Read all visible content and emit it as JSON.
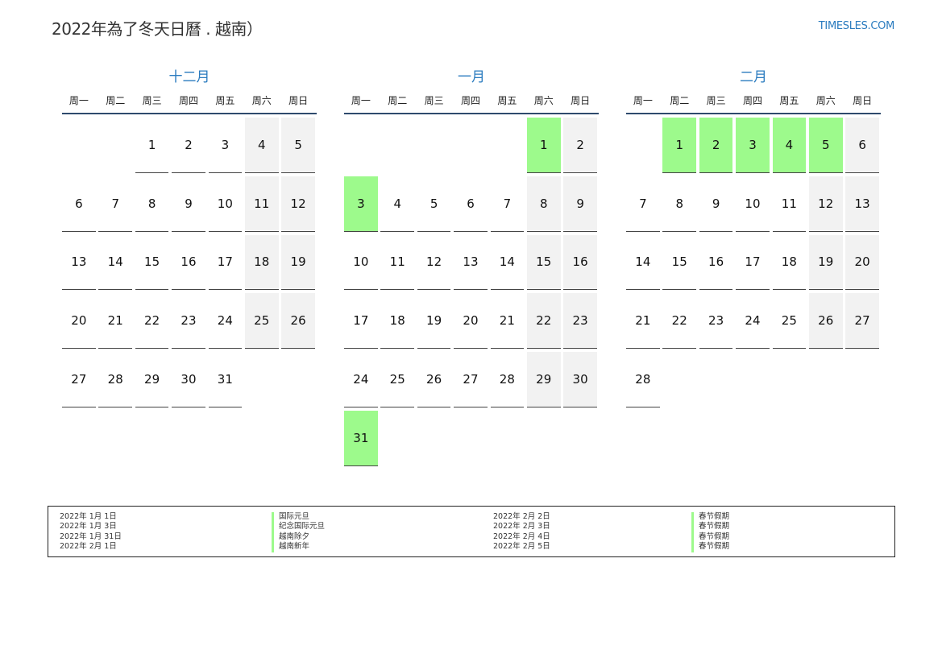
{
  "header": {
    "title": "2022年為了冬天日曆 . 越南）",
    "site": "TIMESLES.COM"
  },
  "weekdays": [
    "周一",
    "周二",
    "周三",
    "周四",
    "周五",
    "周六",
    "周日"
  ],
  "months": [
    {
      "name": "十二月",
      "offset": 2,
      "days": 31,
      "holidays": []
    },
    {
      "name": "一月",
      "offset": 5,
      "days": 31,
      "holidays": [
        1,
        3,
        31
      ]
    },
    {
      "name": "二月",
      "offset": 1,
      "days": 28,
      "holidays": [
        1,
        2,
        3,
        4,
        5
      ]
    }
  ],
  "legend": {
    "left": [
      {
        "date": "2022年 1月 1日",
        "name": "国际元旦"
      },
      {
        "date": "2022年 1月 3日",
        "name": "纪念国际元旦"
      },
      {
        "date": "2022年 1月 31日",
        "name": "越南除夕"
      },
      {
        "date": "2022年 2月 1日",
        "name": "越南新年"
      }
    ],
    "right": [
      {
        "date": "2022年 2月 2日",
        "name": "春节假期"
      },
      {
        "date": "2022年 2月 3日",
        "name": "春节假期"
      },
      {
        "date": "2022年 2月 4日",
        "name": "春节假期"
      },
      {
        "date": "2022年 2月 5日",
        "name": "春节假期"
      }
    ]
  },
  "colors": {
    "holiday": "#9dfa8c",
    "weekend": "#f2f2f2",
    "accent": "#2a7bbf"
  }
}
